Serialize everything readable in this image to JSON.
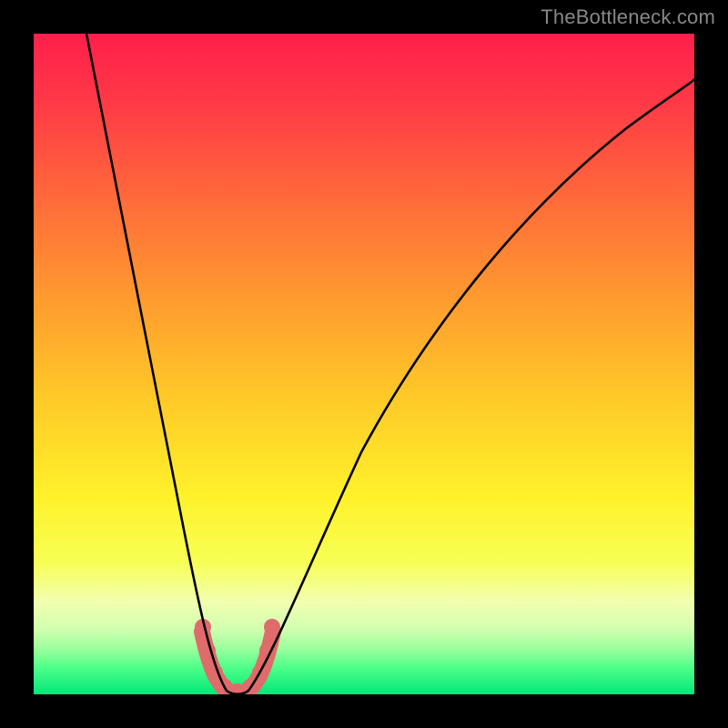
{
  "watermark": "TheBottleneck.com",
  "chart_data": {
    "type": "line",
    "title": "",
    "xlabel": "",
    "ylabel": "",
    "xlim": [
      0,
      100
    ],
    "ylim": [
      0,
      100
    ],
    "gradient_meaning": "Background vertical gradient from red (top, high bottleneck) through orange and yellow to green (bottom, low bottleneck).",
    "series": [
      {
        "name": "bottleneck-curve",
        "description": "V-shaped black curve indicating bottleneck percentage vs component balance. Left branch is steep, minimum near x≈29 at y≈0, right branch rises more gradually toward top-right.",
        "x": [
          8,
          12,
          16,
          20,
          24,
          26,
          28,
          29,
          30,
          32,
          34,
          38,
          45,
          55,
          65,
          75,
          85,
          95,
          100
        ],
        "y": [
          100,
          82,
          63,
          45,
          26,
          14,
          4,
          0,
          0,
          4,
          10,
          22,
          38,
          54,
          66,
          76,
          84,
          90,
          93
        ]
      },
      {
        "name": "highlight-segment",
        "description": "Thick salmon/pink overlay marking the low-bottleneck region near the curve minimum.",
        "x": [
          25.5,
          26.5,
          27.5,
          28.5,
          29.5,
          30.5,
          31.5,
          32.5,
          33.5
        ],
        "y": [
          9.5,
          5,
          2,
          0.5,
          0,
          0.5,
          2,
          5,
          9.5
        ]
      }
    ],
    "gradient_stops": [
      {
        "pos": 0.0,
        "color": "#ff1f4b"
      },
      {
        "pos": 0.1,
        "color": "#ff3847"
      },
      {
        "pos": 0.25,
        "color": "#ff6a3a"
      },
      {
        "pos": 0.4,
        "color": "#ff9a2f"
      },
      {
        "pos": 0.55,
        "color": "#ffc928"
      },
      {
        "pos": 0.7,
        "color": "#fff12a"
      },
      {
        "pos": 0.8,
        "color": "#f7ff55"
      },
      {
        "pos": 0.86,
        "color": "#f2ffb0"
      },
      {
        "pos": 0.9,
        "color": "#d2ffb0"
      },
      {
        "pos": 0.93,
        "color": "#9dff9d"
      },
      {
        "pos": 0.96,
        "color": "#4dff88"
      },
      {
        "pos": 1.0,
        "color": "#00e87a"
      }
    ]
  }
}
